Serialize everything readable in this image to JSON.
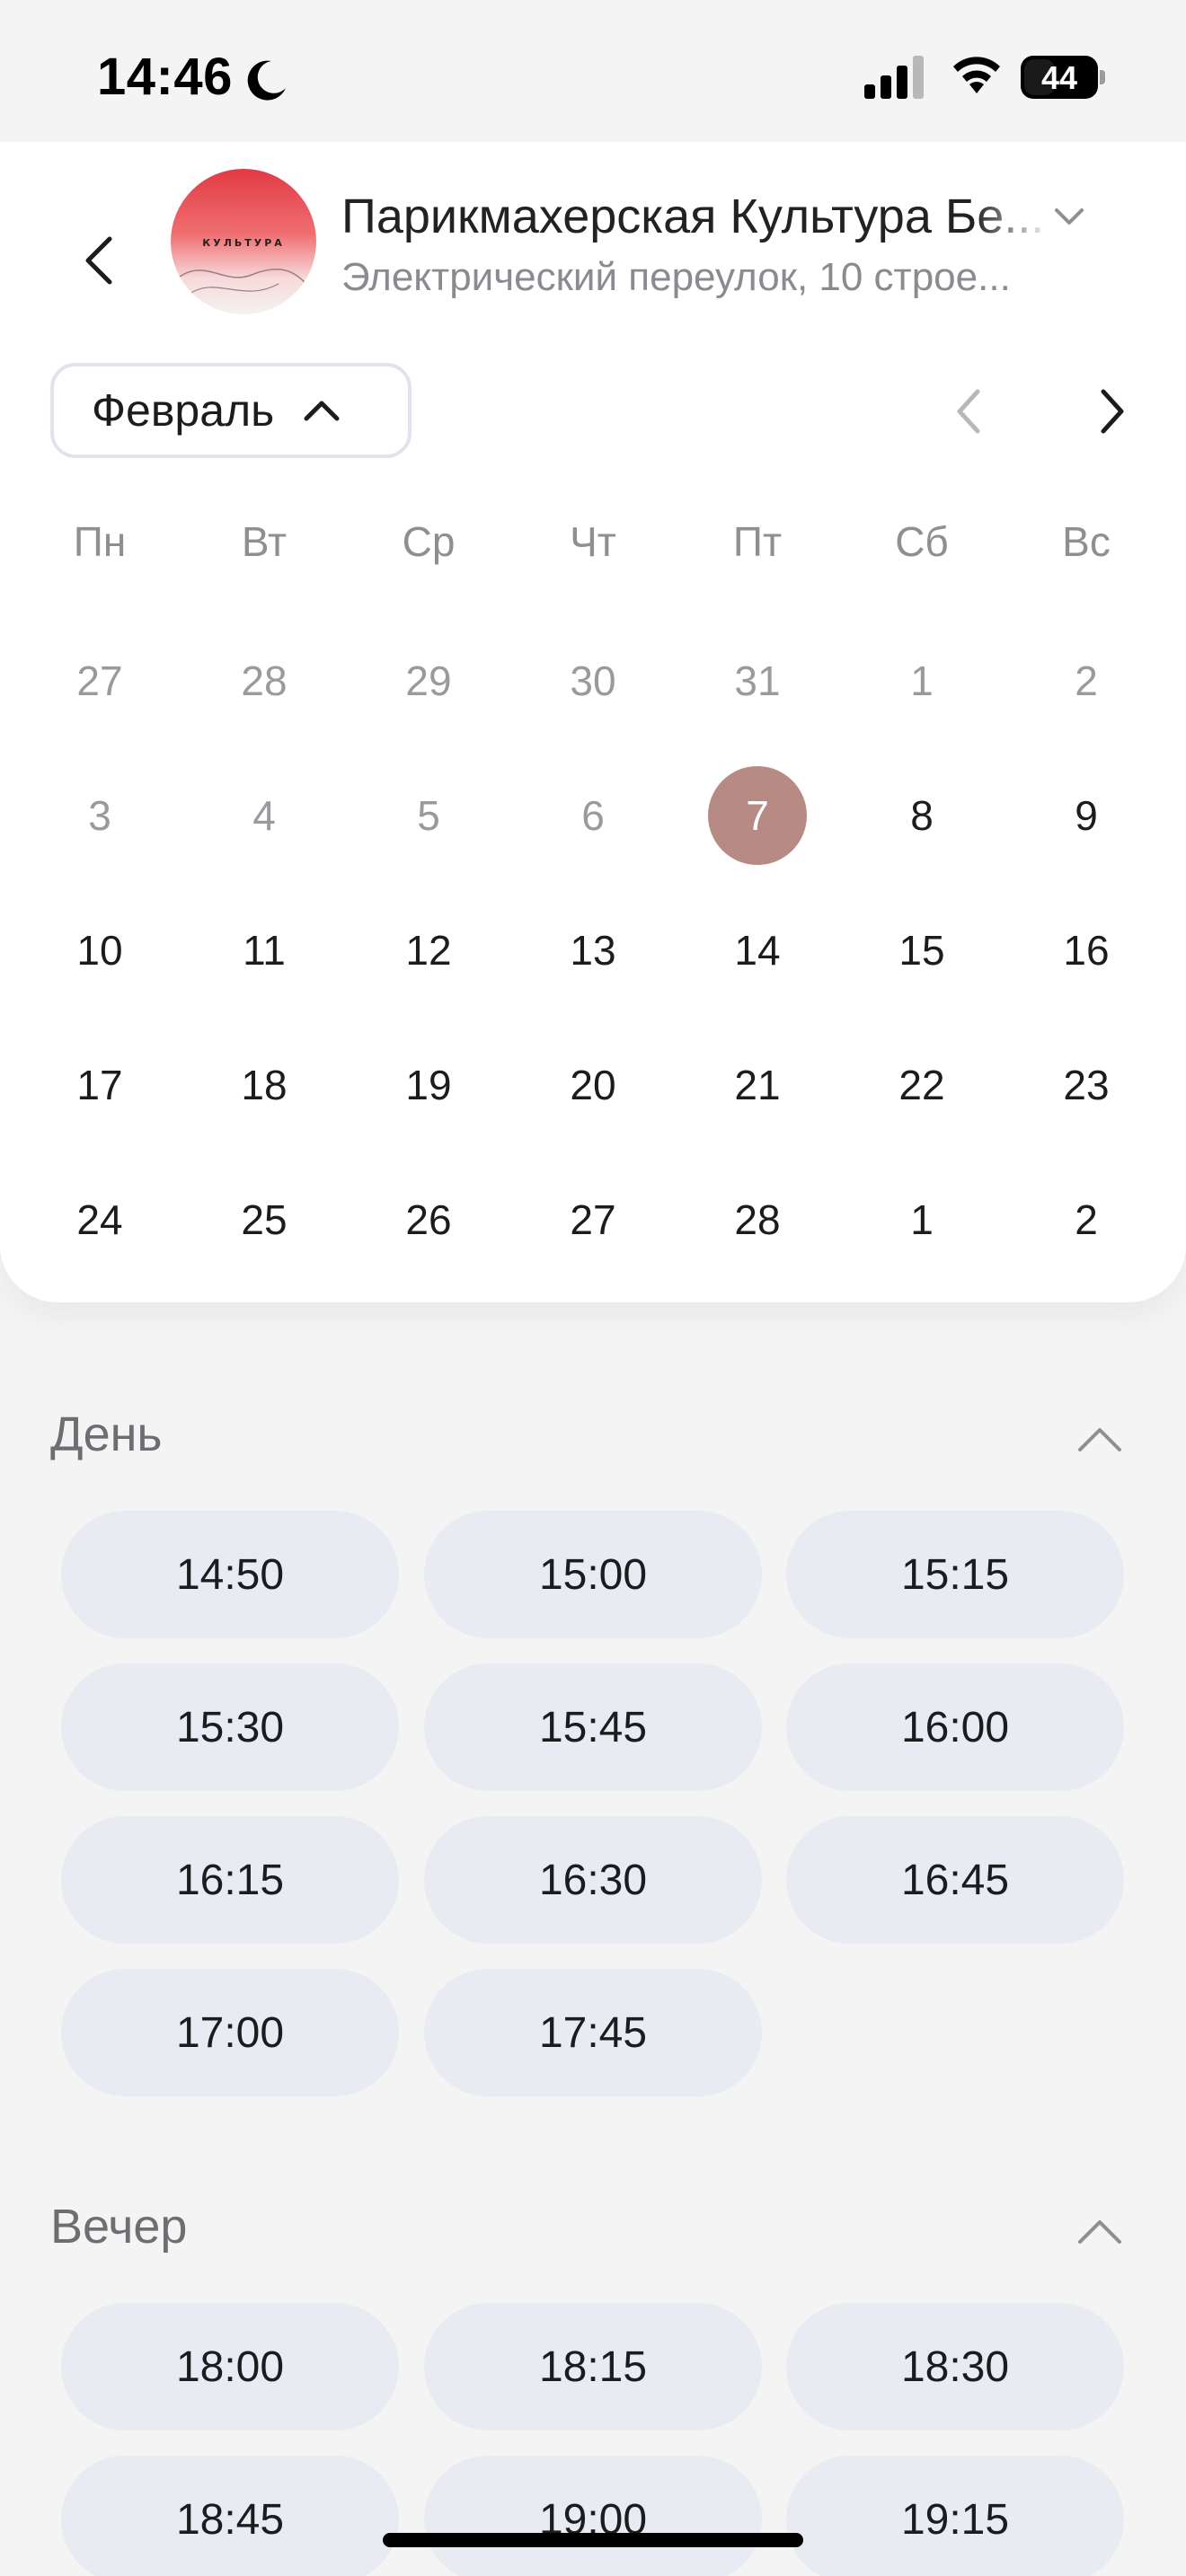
{
  "status_bar": {
    "time": "14:46",
    "battery": "44"
  },
  "header": {
    "salon_name": "Парикмахерская Культура Бе...",
    "salon_address": "Электрический переулок, 10 строе...",
    "logo_text": "КУЛЬТУРА"
  },
  "calendar": {
    "month": "Февраль",
    "weekdays": [
      "Пн",
      "Вт",
      "Ср",
      "Чт",
      "Пт",
      "Сб",
      "Вс"
    ],
    "weeks": [
      [
        "27",
        "28",
        "29",
        "30",
        "31",
        "1",
        "2"
      ],
      [
        "3",
        "4",
        "5",
        "6",
        "7",
        "8",
        "9"
      ],
      [
        "10",
        "11",
        "12",
        "13",
        "14",
        "15",
        "16"
      ],
      [
        "17",
        "18",
        "19",
        "20",
        "21",
        "22",
        "23"
      ],
      [
        "24",
        "25",
        "26",
        "27",
        "28",
        "1",
        "2"
      ]
    ],
    "selected_day": "7"
  },
  "sections": [
    {
      "title": "День",
      "slots": [
        "14:50",
        "15:00",
        "15:15",
        "15:30",
        "15:45",
        "16:00",
        "16:15",
        "16:30",
        "16:45",
        "17:00",
        "17:45"
      ]
    },
    {
      "title": "Вечер",
      "slots": [
        "18:00",
        "18:15",
        "18:30",
        "18:45",
        "19:00",
        "19:15"
      ]
    }
  ],
  "colors": {
    "selected_day": "#b88a84",
    "slot_bg": "#e9ebf2",
    "muted_text": "#9a9a9e",
    "logo_red": "#e23a44"
  },
  "icons": [
    "moon-icon",
    "signal-icon",
    "wifi-icon",
    "battery-icon",
    "back-arrow-icon",
    "chevron-down-icon",
    "chevron-up-icon",
    "chevron-left-icon",
    "chevron-right-icon"
  ]
}
